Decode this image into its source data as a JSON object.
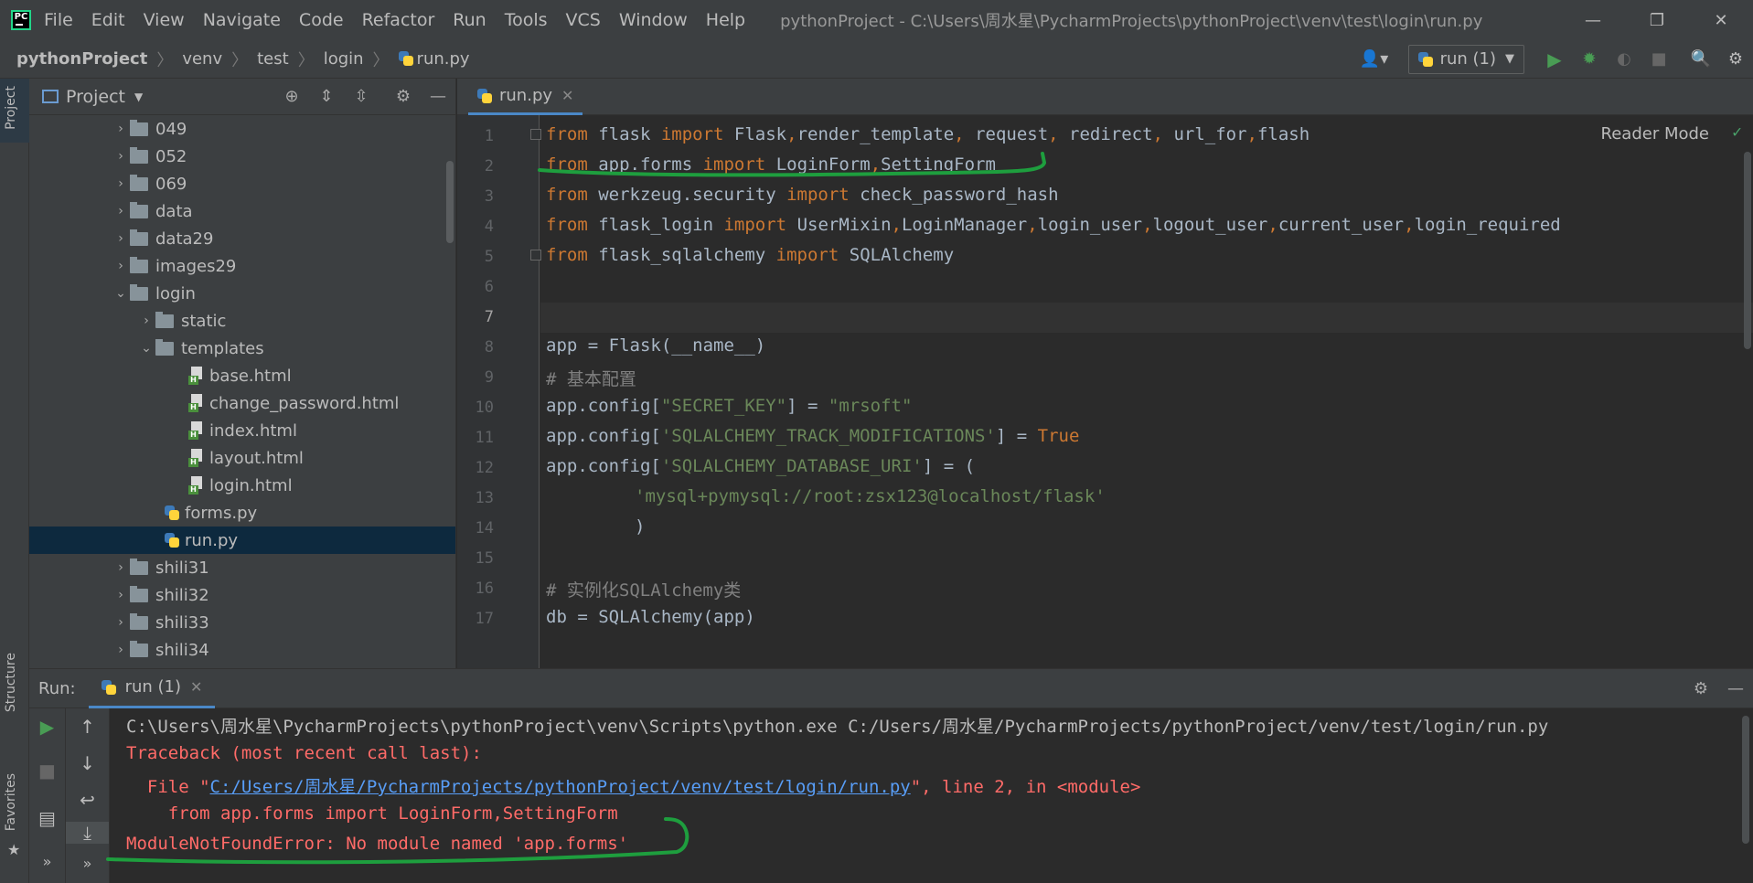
{
  "titlebar": {
    "logo": "PC",
    "menu": [
      "File",
      "Edit",
      "View",
      "Navigate",
      "Code",
      "Refactor",
      "Run",
      "Tools",
      "VCS",
      "Window",
      "Help"
    ],
    "window_title": "pythonProject - C:\\Users\\周水星\\PycharmProjects\\pythonProject\\venv\\test\\login\\run.py",
    "controls": {
      "minimize": "—",
      "restore": "❐",
      "close": "✕"
    }
  },
  "breadcrumb": [
    "pythonProject",
    "venv",
    "test",
    "login",
    "run.py"
  ],
  "toolbar": {
    "run_config": "run (1)"
  },
  "left_stripe": {
    "project_tab": "Project",
    "structure_tab": "Structure",
    "favorites_tab": "Favorites"
  },
  "project_panel": {
    "title": "Project",
    "tree": [
      {
        "label": "049",
        "type": "folder",
        "expanded": false
      },
      {
        "label": "052",
        "type": "folder",
        "expanded": false
      },
      {
        "label": "069",
        "type": "folder",
        "expanded": false
      },
      {
        "label": "data",
        "type": "folder",
        "expanded": false
      },
      {
        "label": "data29",
        "type": "folder",
        "expanded": false
      },
      {
        "label": "images29",
        "type": "folder",
        "expanded": false
      },
      {
        "label": "login",
        "type": "folder",
        "expanded": true
      },
      {
        "label": "static",
        "type": "folder",
        "expanded": false
      },
      {
        "label": "templates",
        "type": "folder",
        "expanded": true
      },
      {
        "label": "base.html",
        "type": "html"
      },
      {
        "label": "change_password.html",
        "type": "html"
      },
      {
        "label": "index.html",
        "type": "html"
      },
      {
        "label": "layout.html",
        "type": "html"
      },
      {
        "label": "login.html",
        "type": "html"
      },
      {
        "label": "forms.py",
        "type": "python"
      },
      {
        "label": "run.py",
        "type": "python",
        "selected": true
      },
      {
        "label": "shili31",
        "type": "folder",
        "expanded": false
      },
      {
        "label": "shili32",
        "type": "folder",
        "expanded": false
      },
      {
        "label": "shili33",
        "type": "folder",
        "expanded": false
      },
      {
        "label": "shili34",
        "type": "folder",
        "expanded": false
      }
    ]
  },
  "editor": {
    "tab_label": "run.py",
    "reader_mode": "Reader Mode",
    "line_numbers": [
      "1",
      "2",
      "3",
      "4",
      "5",
      "6",
      "7",
      "8",
      "9",
      "10",
      "11",
      "12",
      "13",
      "14",
      "15",
      "16",
      "17"
    ],
    "code": {
      "l1": "from flask import Flask,render_template, request, redirect, url_for,flash",
      "l2": "from app.forms import LoginForm,SettingForm",
      "l3": "from werkzeug.security import check_password_hash",
      "l4": "from flask_login import UserMixin,LoginManager,login_user,logout_user,current_user,login_required",
      "l5": "from flask_sqlalchemy import SQLAlchemy",
      "l8": "app = Flask(__name__)",
      "l9": "# 基本配置",
      "l10": "app.config[\"SECRET_KEY\"] = \"mrsoft\"",
      "l11": "app.config['SQLALCHEMY_TRACK_MODIFICATIONS'] = True",
      "l12": "app.config['SQLALCHEMY_DATABASE_URI'] = (",
      "l13": "'mysql+pymysql://root:zsx123@localhost/flask'",
      "l14": ")",
      "l16": "# 实例化SQLAlchemy类",
      "l17": "db = SQLAlchemy(app)"
    }
  },
  "run_panel": {
    "label": "Run:",
    "tab": "run (1)",
    "console": {
      "cmd": "C:\\Users\\周水星\\PycharmProjects\\pythonProject\\venv\\Scripts\\python.exe C:/Users/周水星/PycharmProjects/pythonProject/venv/test/login/run.py",
      "traceback": "Traceback (most recent call last):",
      "file_prefix": "  File \"",
      "file_link": "C:/Users/周水星/PycharmProjects/pythonProject/venv/test/login/run.py",
      "file_suffix": "\", line 2, in <module>",
      "code_line": "    from app.forms import LoginForm,SettingForm",
      "error": "ModuleNotFoundError: No module named 'app.forms'"
    }
  },
  "colors": {
    "keyword": "#cc7832",
    "string": "#6a8759",
    "comment": "#808080",
    "error": "#ff6b68",
    "link": "#589df6",
    "annotation": "#1e9e3e"
  }
}
